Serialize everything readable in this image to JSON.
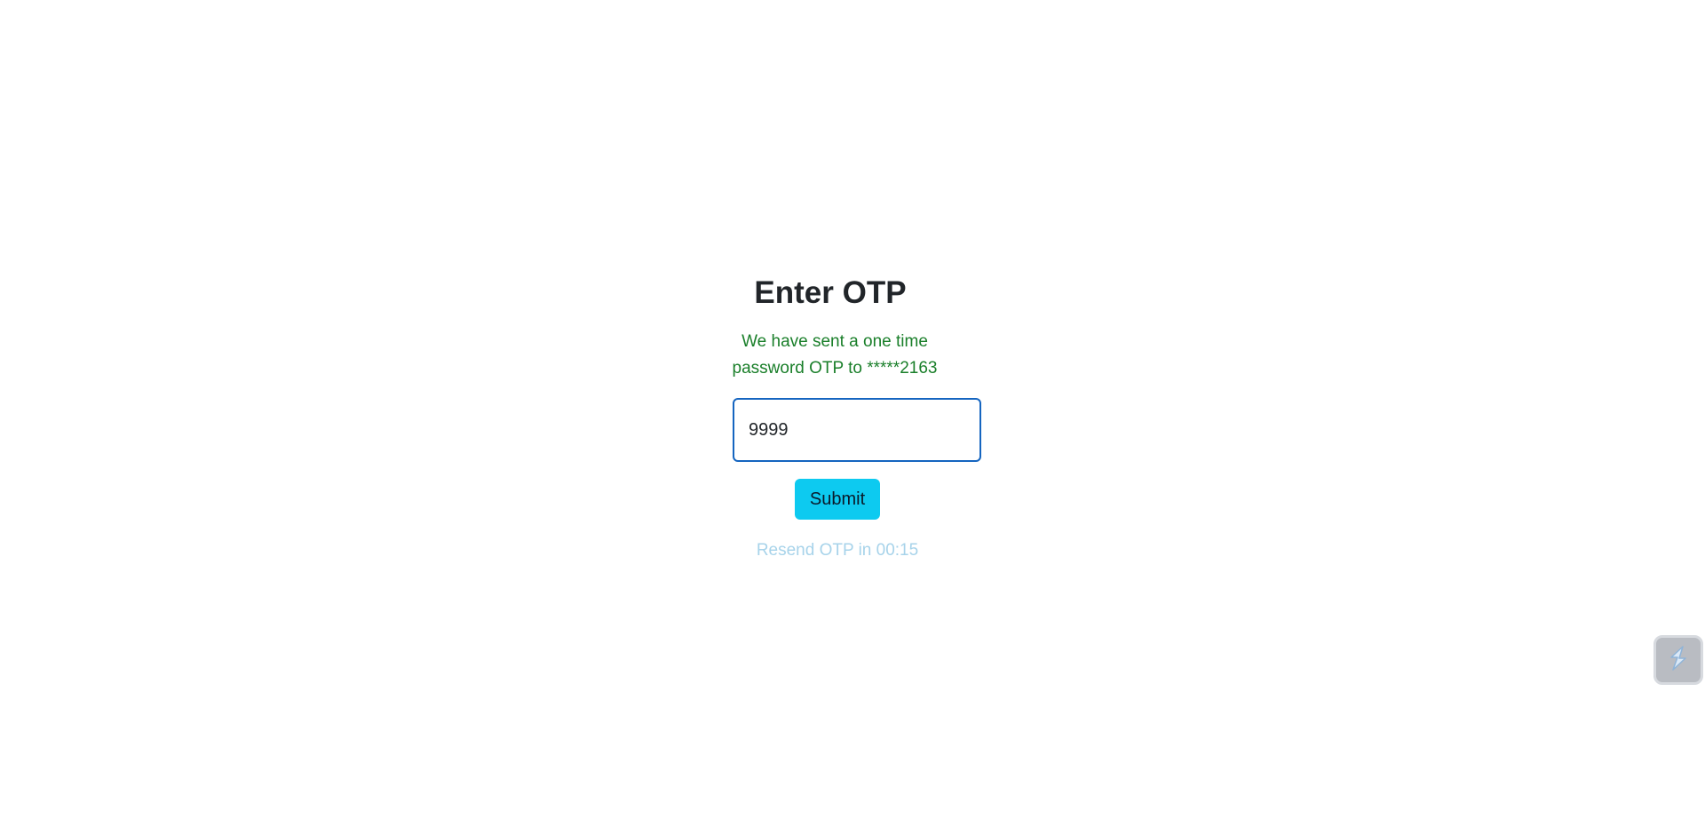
{
  "otp": {
    "title": "Enter OTP",
    "message": "We have sent a one time password OTP to *****2163",
    "input_value": "9999",
    "submit_label": "Submit",
    "resend_text": "Resend OTP in 00:15"
  },
  "widget": {
    "icon": "lightning-bolt-icon"
  },
  "colors": {
    "title": "#212529",
    "message": "#1a7f2a",
    "input_border": "#1565c0",
    "submit_bg": "#0dcaf0",
    "resend": "#a7d3ea",
    "widget_bg": "#b9bcc2"
  }
}
